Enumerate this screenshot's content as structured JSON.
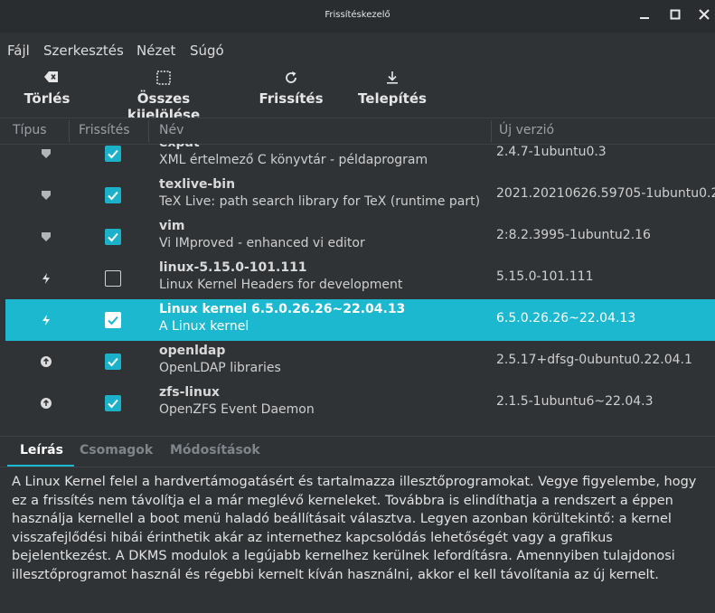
{
  "window": {
    "title": "Frissítéskezelő"
  },
  "menu": {
    "file": "Fájl",
    "edit": "Szerkesztés",
    "view": "Nézet",
    "help": "Súgó"
  },
  "toolbar": {
    "clear": "Törlés",
    "select_all": "Összes kijelölése",
    "refresh": "Frissítés",
    "install": "Telepítés"
  },
  "columns": {
    "type": "Típus",
    "update": "Frissítés",
    "name": "Név",
    "new_version": "Új verzió"
  },
  "updates": [
    {
      "type_icon": "shield-icon",
      "checked": true,
      "name": "expat",
      "description": "XML értelmező C könyvtár - példaprogram",
      "version": "2.4.7-1ubuntu0.3"
    },
    {
      "type_icon": "shield-icon",
      "checked": true,
      "name": "texlive-bin",
      "description": "TeX Live: path search library for TeX (runtime part)",
      "version": "2021.20210626.59705-1ubuntu0.2"
    },
    {
      "type_icon": "shield-icon",
      "checked": true,
      "name": "vim",
      "description": "Vi IMproved - enhanced vi editor",
      "version": "2:8.2.3995-1ubuntu2.16"
    },
    {
      "type_icon": "lightning-icon",
      "checked": false,
      "name": "linux-5.15.0-101.111",
      "description": "Linux Kernel Headers for development",
      "version": "5.15.0-101.111"
    },
    {
      "type_icon": "lightning-icon",
      "checked": true,
      "name": "Linux kernel 6.5.0.26.26~22.04.13",
      "description": "A Linux kernel",
      "version": "6.5.0.26.26~22.04.13",
      "selected": true
    },
    {
      "type_icon": "up-arrow-circle-icon",
      "checked": true,
      "name": "openldap",
      "description": "OpenLDAP libraries",
      "version": "2.5.17+dfsg-0ubuntu0.22.04.1"
    },
    {
      "type_icon": "up-arrow-circle-icon",
      "checked": true,
      "name": "zfs-linux",
      "description": "OpenZFS Event Daemon",
      "version": "2.1.5-1ubuntu6~22.04.3"
    }
  ],
  "tabs": {
    "description": "Leírás",
    "packages": "Csomagok",
    "changes": "Módosítások"
  },
  "details": {
    "lines": [
      "A Linux Kernel felel a hardvertámogatásért és tartalmazza illesztőprogramokat. Vegye figyelembe, hogy",
      "ez a frissítés nem távolítja el a már meglévő kerneleket. Továbbra is elindíthatja a rendszert a éppen",
      "használja kernellel a boot menü haladó beállításait választva. Legyen azonban körültekintő: a kernel",
      "visszafejlődési hibái érinthetik akár az internethez kapcsolódás lehetőségét vagy a grafikus",
      "bejelentkezést. A DKMS modulok a legújabb kernelhez kerülnek lefordításra. Amennyiben tulajdonosi",
      "illesztőprogramot használ és régebbi kernelt kíván használni, akkor el kell távolítania az új kernelt."
    ]
  },
  "colors": {
    "accent": "#1cb8d0",
    "background": "#2f3336",
    "checkbox": "#1bb1c9"
  }
}
